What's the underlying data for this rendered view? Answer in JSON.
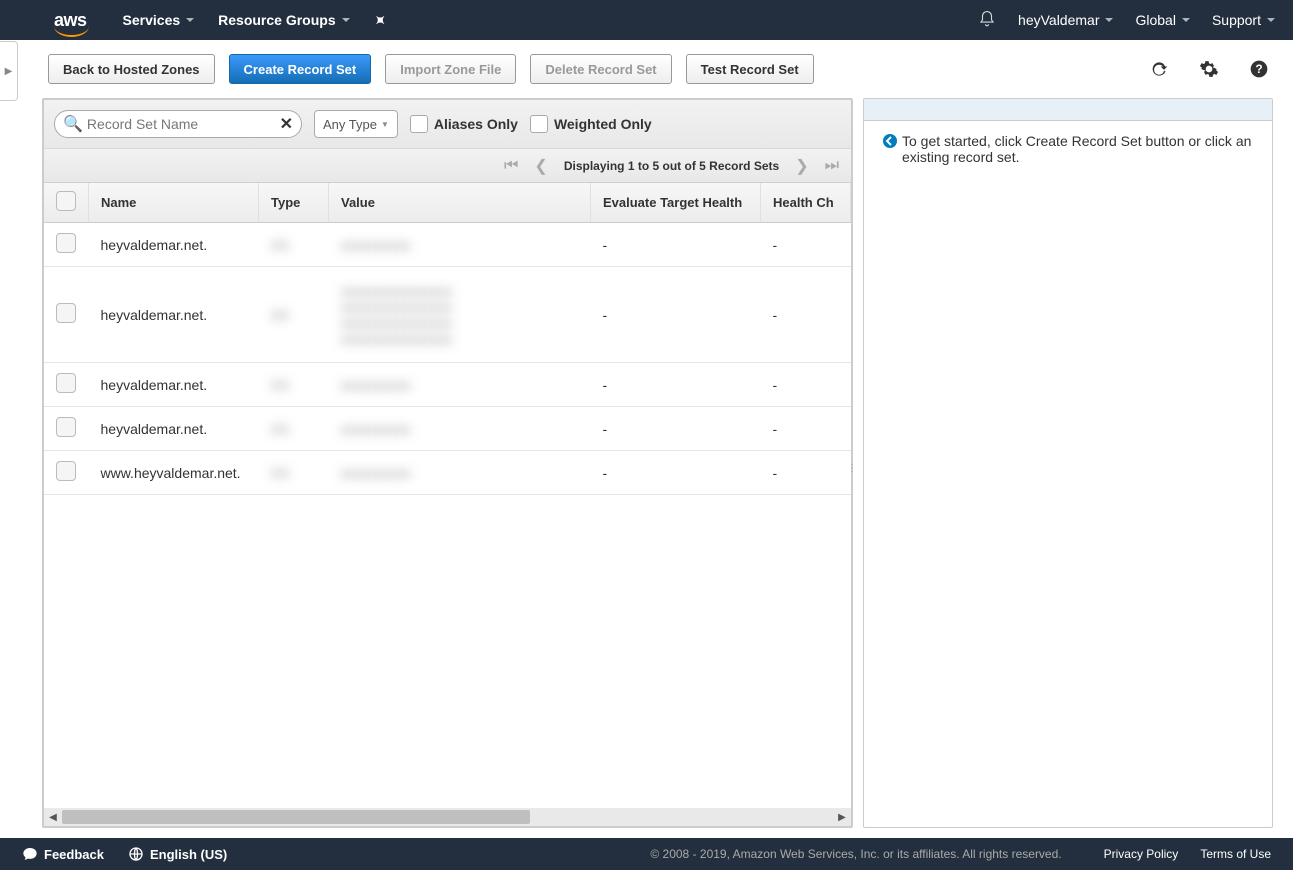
{
  "topnav": {
    "logo": "aws",
    "services": "Services",
    "resource_groups": "Resource Groups",
    "user": "heyValdemar",
    "region": "Global",
    "support": "Support"
  },
  "toolbar": {
    "back": "Back to Hosted Zones",
    "create": "Create Record Set",
    "import": "Import Zone File",
    "delete": "Delete Record Set",
    "test": "Test Record Set"
  },
  "filters": {
    "search_placeholder": "Record Set Name",
    "type_select": "Any Type",
    "aliases_only": "Aliases Only",
    "weighted_only": "Weighted Only"
  },
  "pager": {
    "text": "Displaying 1 to 5 out of 5 Record Sets"
  },
  "table": {
    "cols": {
      "name": "Name",
      "type": "Type",
      "value": "Value",
      "eth": "Evaluate Target Health",
      "hc": "Health Ch"
    },
    "rows": [
      {
        "name": "heyvaldemar.net.",
        "eth": "-",
        "hc": "-"
      },
      {
        "name": "heyvaldemar.net.",
        "eth": "-",
        "hc": "-"
      },
      {
        "name": "heyvaldemar.net.",
        "eth": "-",
        "hc": "-"
      },
      {
        "name": "heyvaldemar.net.",
        "eth": "-",
        "hc": "-"
      },
      {
        "name": "www.heyvaldemar.net.",
        "eth": "-",
        "hc": "-"
      }
    ]
  },
  "right": {
    "message": "To get started, click Create Record Set button or click an existing record set."
  },
  "footer": {
    "feedback": "Feedback",
    "language": "English (US)",
    "copyright": "© 2008 - 2019, Amazon Web Services, Inc. or its affiliates. All rights reserved.",
    "privacy": "Privacy Policy",
    "terms": "Terms of Use"
  }
}
